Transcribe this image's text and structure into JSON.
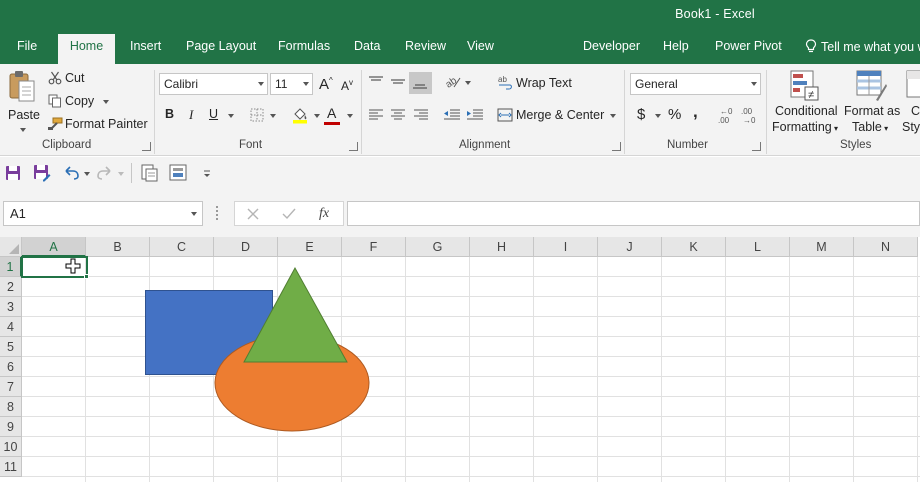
{
  "window": {
    "title": "Book1  -  Excel"
  },
  "tabs": [
    {
      "id": "file",
      "label": "File"
    },
    {
      "id": "home",
      "label": "Home",
      "active": true
    },
    {
      "id": "insert",
      "label": "Insert"
    },
    {
      "id": "pagelayout",
      "label": "Page Layout"
    },
    {
      "id": "formulas",
      "label": "Formulas"
    },
    {
      "id": "data",
      "label": "Data"
    },
    {
      "id": "review",
      "label": "Review"
    },
    {
      "id": "view",
      "label": "View"
    },
    {
      "id": "developer",
      "label": "Developer"
    },
    {
      "id": "help",
      "label": "Help"
    },
    {
      "id": "powerpivot",
      "label": "Power Pivot"
    }
  ],
  "tell_me": {
    "label": "Tell me what you w",
    "icon": "lightbulb-icon"
  },
  "clipboard": {
    "group_label": "Clipboard",
    "paste_label": "Paste",
    "cut_label": "Cut",
    "copy_label": "Copy",
    "format_painter_label": "Format Painter"
  },
  "font": {
    "group_label": "Font",
    "font_name": "Calibri",
    "font_size": "11",
    "bold": "B",
    "italic": "I",
    "underline": "U",
    "grow_label": "A",
    "shrink_label": "A",
    "highlight_color": "#ffff00",
    "font_color": "#c00000",
    "font_color_label": "A"
  },
  "alignment": {
    "group_label": "Alignment",
    "wrap_text_label": "Wrap Text",
    "merge_center_label": "Merge & Center"
  },
  "number": {
    "group_label": "Number",
    "format": "General",
    "currency": "$",
    "percent": "%",
    "comma": ","
  },
  "styles": {
    "group_label": "Styles",
    "conditional_formatting": [
      "Conditional",
      "Formatting"
    ],
    "format_as_table": [
      "Format as",
      "Table"
    ],
    "cell_styles": [
      "Ce",
      "Styl"
    ]
  },
  "formula_bar": {
    "name_box": "A1",
    "fx_label": "fx",
    "formula": ""
  },
  "grid": {
    "columns": [
      "A",
      "B",
      "C",
      "D",
      "E",
      "F",
      "G",
      "H",
      "I",
      "J",
      "K",
      "L",
      "M",
      "N"
    ],
    "rows": [
      "1",
      "2",
      "3",
      "4",
      "5",
      "6",
      "7",
      "8",
      "9",
      "10",
      "11"
    ],
    "selected_column": "A",
    "selected_row": "1"
  },
  "shapes": {
    "rectangle_color": "#4472c4",
    "ellipse_color": "#ed7d31",
    "triangle_color": "#70ad47"
  },
  "colors": {
    "brand": "#217346",
    "ribbon_bg": "#f3f3f3"
  }
}
